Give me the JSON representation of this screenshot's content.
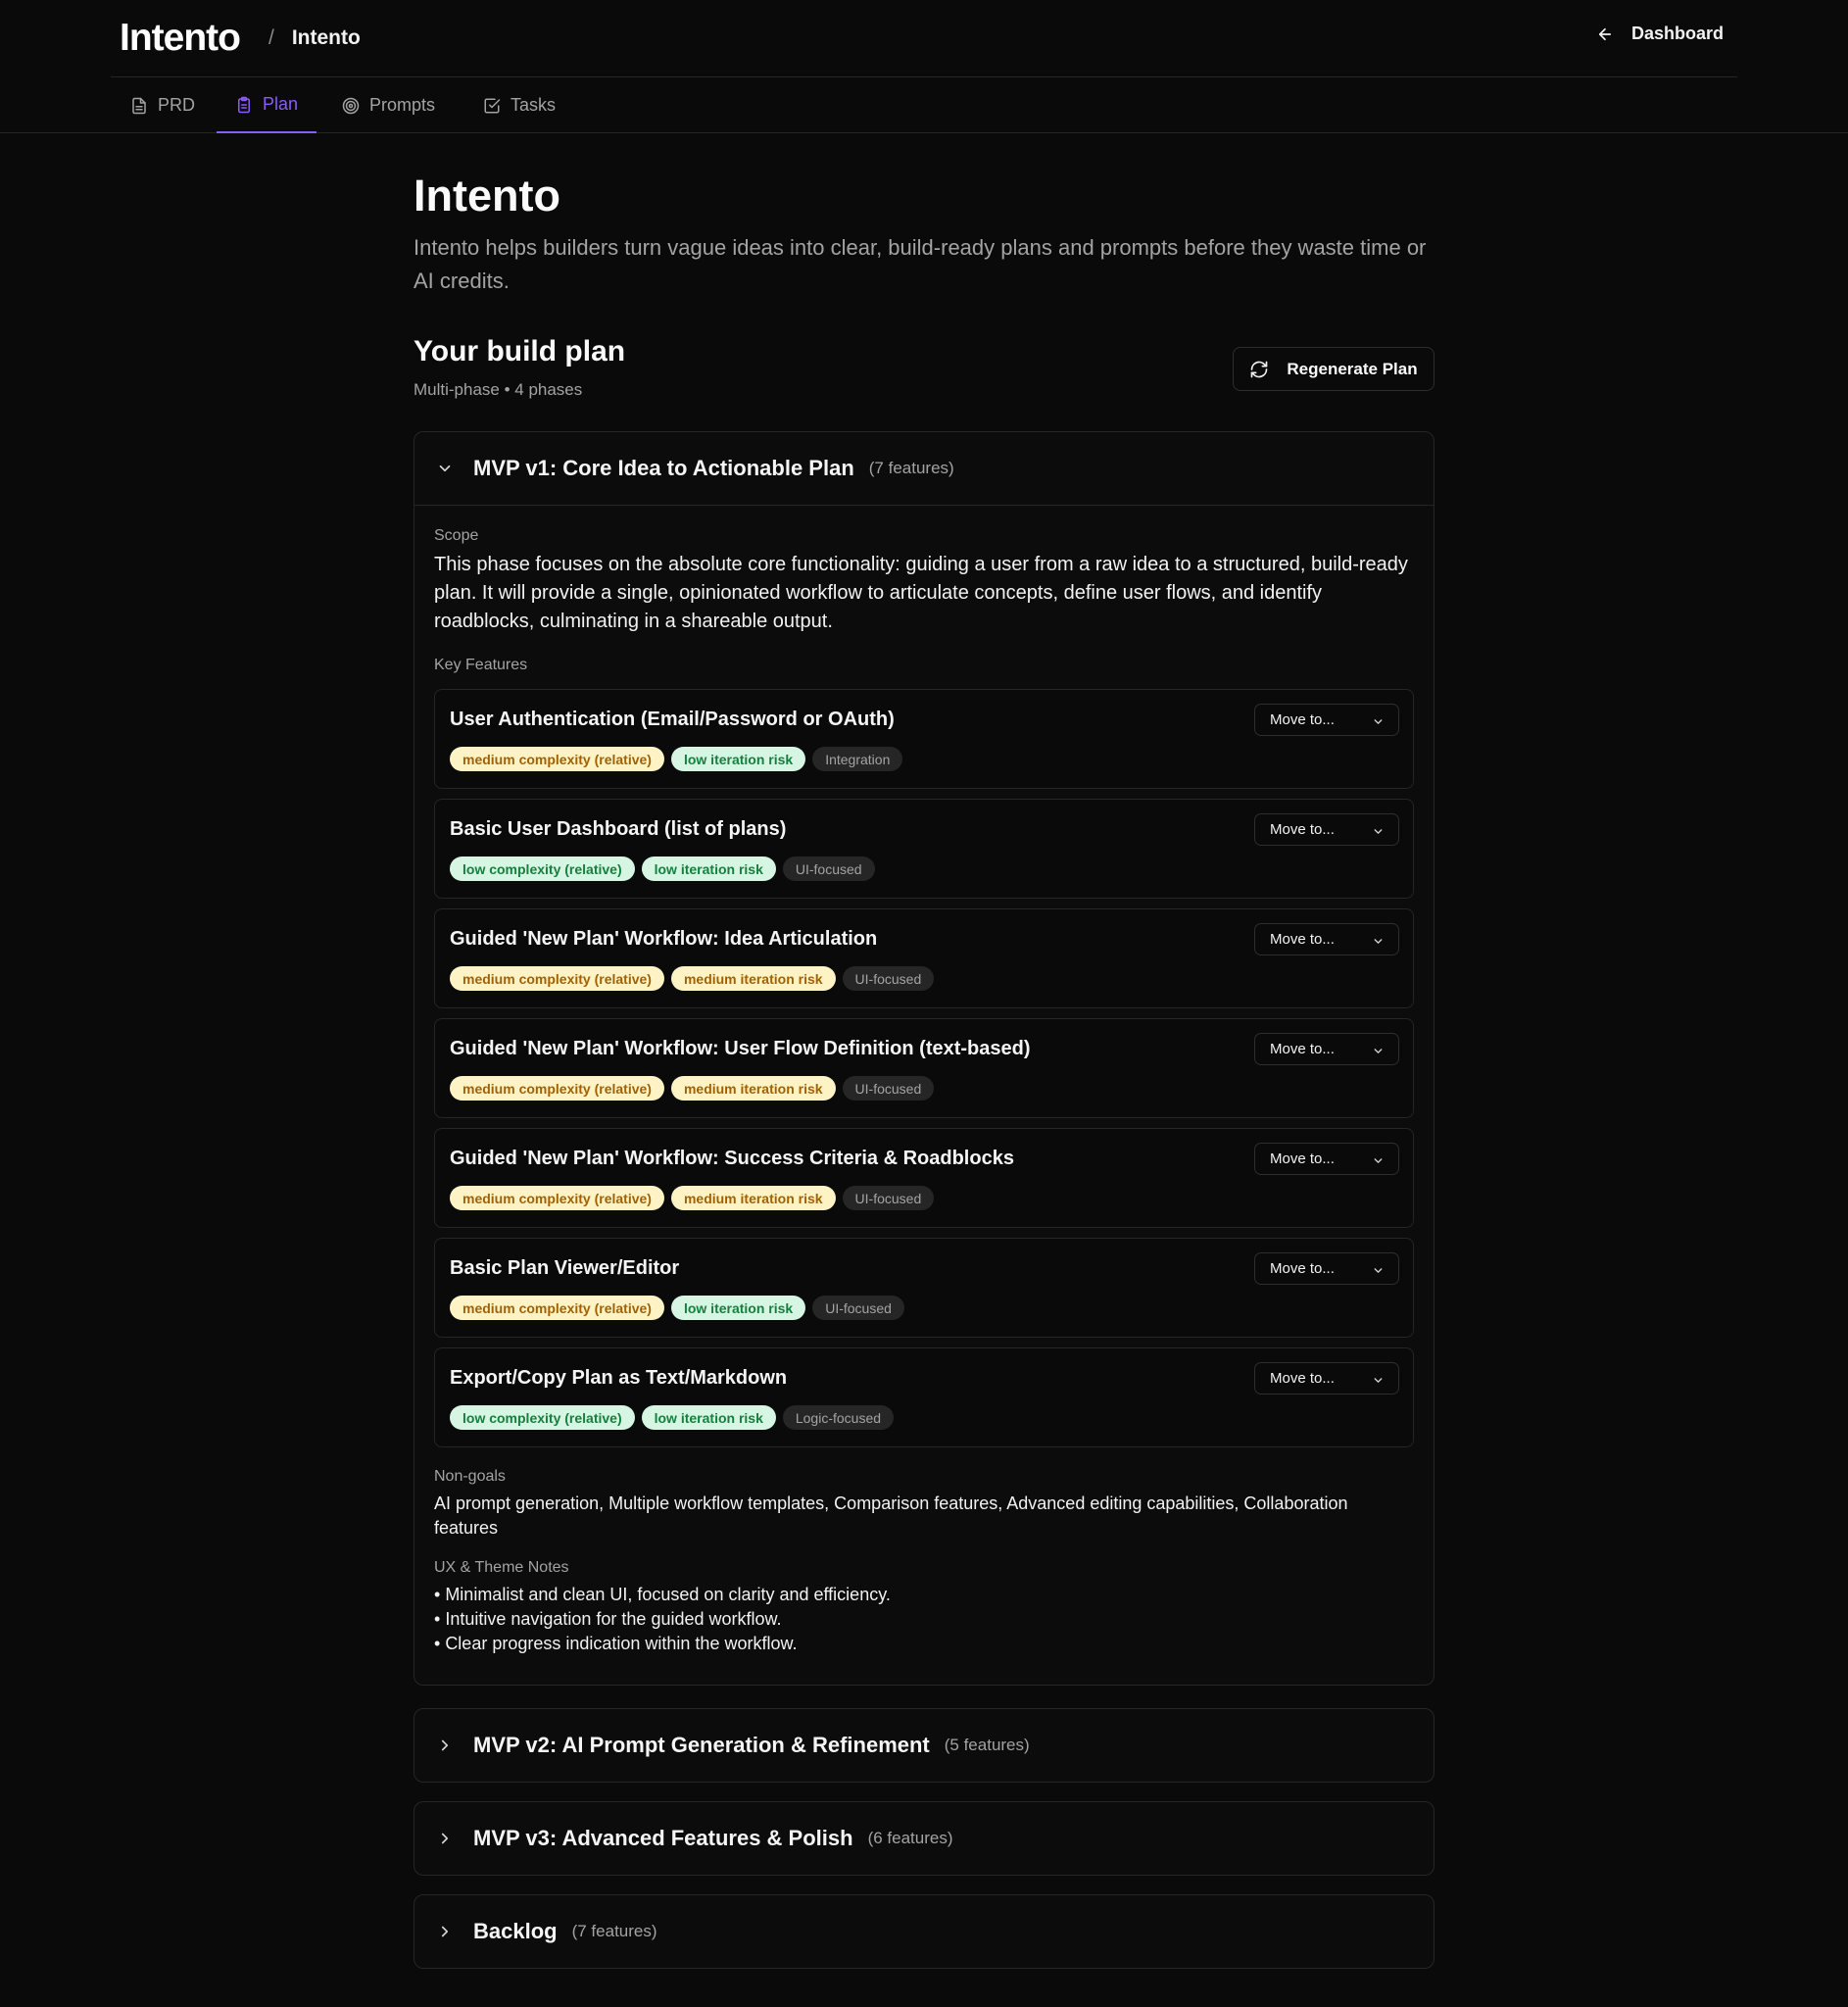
{
  "header": {
    "logo": "Intento",
    "separator": "/",
    "breadcrumb": "Intento",
    "dashboard_label": "Dashboard"
  },
  "tabs": [
    {
      "label": "PRD",
      "icon": "file-icon"
    },
    {
      "label": "Plan",
      "icon": "clipboard-icon"
    },
    {
      "label": "Prompts",
      "icon": "target-icon"
    },
    {
      "label": "Tasks",
      "icon": "checkbox-icon"
    }
  ],
  "active_tab": "Plan",
  "project": {
    "title": "Intento",
    "description": "Intento helps builders turn vague ideas into clear, build-ready plans and prompts before they waste time or AI credits."
  },
  "plan": {
    "title": "Your build plan",
    "subtitle": "Multi-phase • 4 phases",
    "regenerate_label": "Regenerate Plan"
  },
  "phases": [
    {
      "name": "MVP v1: Core Idea to Actionable Plan",
      "count": "(7 features)",
      "expanded": true,
      "scope_label": "Scope",
      "scope": "This phase focuses on the absolute core functionality: guiding a user from a raw idea to a structured, build-ready plan. It will provide a single, opinionated workflow to articulate concepts, define user flows, and identify roadblocks, culminating in a shareable output.",
      "features_label": "Key Features",
      "move_label": "Move to...",
      "features": [
        {
          "title": "User Authentication (Email/Password or OAuth)",
          "complexity": "medium complexity (relative)",
          "risk": "low iteration risk",
          "tag": "Integration"
        },
        {
          "title": "Basic User Dashboard (list of plans)",
          "complexity": "low complexity (relative)",
          "risk": "low iteration risk",
          "tag": "UI-focused"
        },
        {
          "title": "Guided 'New Plan' Workflow: Idea Articulation",
          "complexity": "medium complexity (relative)",
          "risk": "medium iteration risk",
          "tag": "UI-focused"
        },
        {
          "title": "Guided 'New Plan' Workflow: User Flow Definition (text-based)",
          "complexity": "medium complexity (relative)",
          "risk": "medium iteration risk",
          "tag": "UI-focused"
        },
        {
          "title": "Guided 'New Plan' Workflow: Success Criteria & Roadblocks",
          "complexity": "medium complexity (relative)",
          "risk": "medium iteration risk",
          "tag": "UI-focused"
        },
        {
          "title": "Basic Plan Viewer/Editor",
          "complexity": "medium complexity (relative)",
          "risk": "low iteration risk",
          "tag": "UI-focused"
        },
        {
          "title": "Export/Copy Plan as Text/Markdown",
          "complexity": "low complexity (relative)",
          "risk": "low iteration risk",
          "tag": "Logic-focused"
        }
      ],
      "nongoals_label": "Non-goals",
      "nongoals": "AI prompt generation, Multiple workflow templates, Comparison features, Advanced editing capabilities, Collaboration features",
      "ux_label": "UX & Theme Notes",
      "ux_notes": [
        "Minimalist and clean UI, focused on clarity and efficiency.",
        "Intuitive navigation for the guided workflow.",
        "Clear progress indication within the workflow."
      ]
    },
    {
      "name": "MVP v2: AI Prompt Generation & Refinement",
      "count": "(5 features)",
      "expanded": false
    },
    {
      "name": "MVP v3: Advanced Features & Polish",
      "count": "(6 features)",
      "expanded": false
    },
    {
      "name": "Backlog",
      "count": "(7 features)",
      "expanded": false
    }
  ],
  "colors": {
    "background": "#0a0a0a",
    "accent": "#8b5cf6",
    "medium_badge_bg": "#fdf3c4",
    "low_badge_bg": "#d6f5e3",
    "tag_badge_bg": "#262626"
  }
}
